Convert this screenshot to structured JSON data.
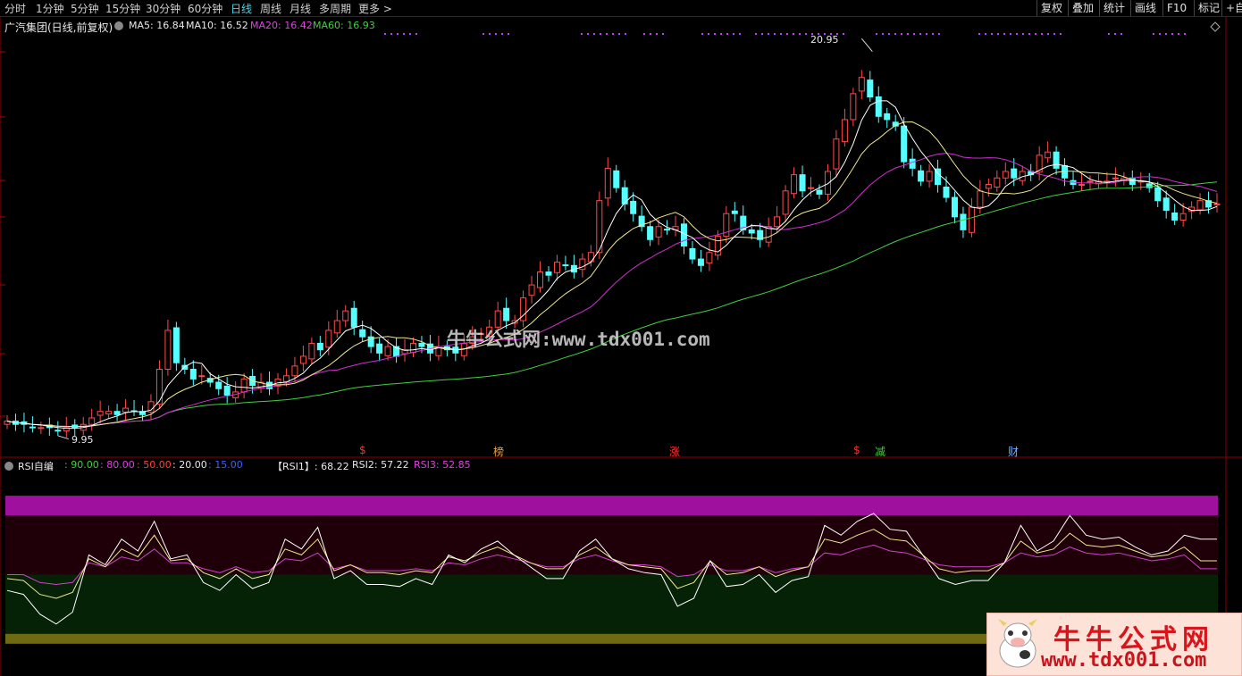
{
  "toolbar": {
    "periods": [
      "分时",
      "1分钟",
      "5分钟",
      "15分钟",
      "30分钟",
      "60分钟",
      "日线",
      "周线",
      "月线",
      "多周期",
      "更多 >"
    ],
    "active_period": "日线",
    "right_buttons": [
      "复权",
      "叠加",
      "统计",
      "画线",
      "F10",
      "标记",
      "+自"
    ]
  },
  "main_panel": {
    "stock_title": "广汽集团(日线,前复权)",
    "ma_labels": [
      {
        "text": "MA5: 16.84",
        "color": "#e8e8e8"
      },
      {
        "text": "MA10: 16.52",
        "color": "#e8e8e8"
      },
      {
        "text": "MA20: 16.42",
        "color": "#e040e0"
      },
      {
        "text": "MA60: 16.93",
        "color": "#40d040"
      }
    ],
    "high_label": "20.95",
    "low_label": "9.95",
    "watermark": "牛牛公式网:www.tdx001.com",
    "event_markers": [
      {
        "text": "$",
        "color": "#ff3030"
      },
      {
        "text": "榜",
        "color": "#e8a040"
      },
      {
        "text": "涨",
        "color": "#ff3030"
      },
      {
        "text": "$",
        "color": "#ff3030"
      },
      {
        "text": "减",
        "color": "#40d040"
      },
      {
        "text": "财",
        "color": "#6ab0ff"
      }
    ]
  },
  "rsi_panel": {
    "name": "RSI自编",
    "levels": [
      {
        "text": ": 90.00",
        "color": "#40d040"
      },
      {
        "text": ": 80.00",
        "color": "#e040e0"
      },
      {
        "text": ": 50.00",
        "color": "#ff4040"
      },
      {
        "text": ": 20.00",
        "color": "#e8e8e8"
      },
      {
        "text": ": 15.00",
        "color": "#4060ff"
      }
    ],
    "values": [
      {
        "text": "【RSI1】: 68.22",
        "color": "#e8e8e8"
      },
      {
        "text": "RSI2: 57.22",
        "color": "#e8e8e8"
      },
      {
        "text": "RSI3: 52.85",
        "color": "#e040e0"
      }
    ]
  },
  "logo": {
    "title": "牛牛公式网",
    "url": "www.tdx001.com"
  },
  "chart_data": [
    {
      "type": "candlestick",
      "title": "广汽集团(日线,前复权)",
      "ylim": [
        9.5,
        22.5
      ],
      "indicators": {
        "MA5": 16.84,
        "MA10": 16.52,
        "MA20": 16.42,
        "MA60": 16.93
      },
      "series": [
        {
          "name": "close",
          "values": [
            10.2,
            10.1,
            10.1,
            10.0,
            10.0,
            10.0,
            9.9,
            10.0,
            10.0,
            10.1,
            10.3,
            10.5,
            10.5,
            10.4,
            10.6,
            10.5,
            10.4,
            10.8,
            11.8,
            13.0,
            12.0,
            11.8,
            11.5,
            11.6,
            11.4,
            11.2,
            11.0,
            11.1,
            11.5,
            11.3,
            11.4,
            11.2,
            11.5,
            11.6,
            11.9,
            12.2,
            12.6,
            12.4,
            13.0,
            13.3,
            13.6,
            13.1,
            12.8,
            12.5,
            12.3,
            12.5,
            12.2,
            12.4,
            12.6,
            12.5,
            12.3,
            12.5,
            12.4,
            12.3,
            12.6,
            12.8,
            12.9,
            13.1,
            13.6,
            13.3,
            13.3,
            14.0,
            14.4,
            14.8,
            14.7,
            15.1,
            15.0,
            14.8,
            15.2,
            15.4,
            17.0,
            18.0,
            17.4,
            16.9,
            16.6,
            16.2,
            15.8,
            16.2,
            16.1,
            16.2,
            15.6,
            15.2,
            15.0,
            15.4,
            15.9,
            16.6,
            16.6,
            16.1,
            16.0,
            15.8,
            16.2,
            16.5,
            17.3,
            17.8,
            17.3,
            17.4,
            17.2,
            17.9,
            18.9,
            19.5,
            20.3,
            20.8,
            20.2,
            19.6,
            19.5,
            19.3,
            18.2,
            18.0,
            17.6,
            17.9,
            17.5,
            17.1,
            16.5,
            16.1,
            16.8,
            17.3,
            17.5,
            17.7,
            17.9,
            17.7,
            17.9,
            17.8,
            18.4,
            18.5,
            18.0,
            17.7,
            17.5,
            17.5,
            17.6,
            17.6,
            17.6,
            17.7,
            17.7,
            17.5,
            17.6,
            17.4,
            17.0,
            16.7,
            16.4,
            16.6,
            16.8,
            17.0,
            16.8,
            16.9
          ]
        }
      ],
      "last_close_ma": {
        "MA5": 16.84
      }
    },
    {
      "type": "line",
      "title": "RSI自编",
      "ylim": [
        0,
        100
      ],
      "levels": [
        90,
        80,
        50,
        20,
        15
      ],
      "series": [
        {
          "name": "RSI1",
          "values": [
            42,
            40,
            30,
            25,
            31,
            60,
            55,
            68,
            62,
            77,
            58,
            60,
            46,
            42,
            50,
            43,
            46,
            68,
            63,
            74,
            48,
            52,
            45,
            45,
            44,
            48,
            45,
            60,
            56,
            63,
            67,
            60,
            54,
            48,
            48,
            62,
            68,
            58,
            53,
            51,
            50,
            34,
            38,
            57,
            44,
            45,
            50,
            41,
            47,
            49,
            75,
            70,
            77,
            81,
            73,
            72,
            60,
            48,
            45,
            47,
            47,
            56,
            75,
            62,
            67,
            80,
            70,
            68,
            69,
            64,
            60,
            62,
            70,
            68,
            68
          ]
        },
        {
          "name": "RSI2",
          "values": [
            48,
            47,
            40,
            38,
            41,
            58,
            54,
            63,
            59,
            70,
            57,
            58,
            51,
            48,
            53,
            48,
            50,
            63,
            60,
            68,
            52,
            55,
            51,
            51,
            50,
            52,
            51,
            59,
            57,
            61,
            64,
            60,
            56,
            53,
            53,
            60,
            64,
            58,
            55,
            54,
            53,
            43,
            46,
            57,
            50,
            51,
            54,
            49,
            52,
            54,
            68,
            66,
            70,
            73,
            68,
            67,
            60,
            53,
            51,
            52,
            52,
            56,
            67,
            61,
            63,
            71,
            65,
            64,
            65,
            62,
            59,
            60,
            64,
            57,
            57
          ]
        },
        {
          "name": "RSI3",
          "values": [
            50,
            50,
            46,
            45,
            46,
            56,
            54,
            59,
            57,
            63,
            56,
            56,
            53,
            51,
            54,
            51,
            52,
            58,
            57,
            61,
            53,
            55,
            52,
            52,
            52,
            53,
            52,
            56,
            55,
            58,
            60,
            58,
            56,
            54,
            54,
            58,
            60,
            57,
            55,
            55,
            54,
            49,
            50,
            55,
            52,
            52,
            54,
            51,
            53,
            54,
            61,
            60,
            63,
            65,
            62,
            61,
            58,
            55,
            54,
            54,
            54,
            56,
            61,
            59,
            60,
            64,
            61,
            60,
            61,
            59,
            57,
            58,
            60,
            53,
            53
          ]
        }
      ]
    }
  ]
}
